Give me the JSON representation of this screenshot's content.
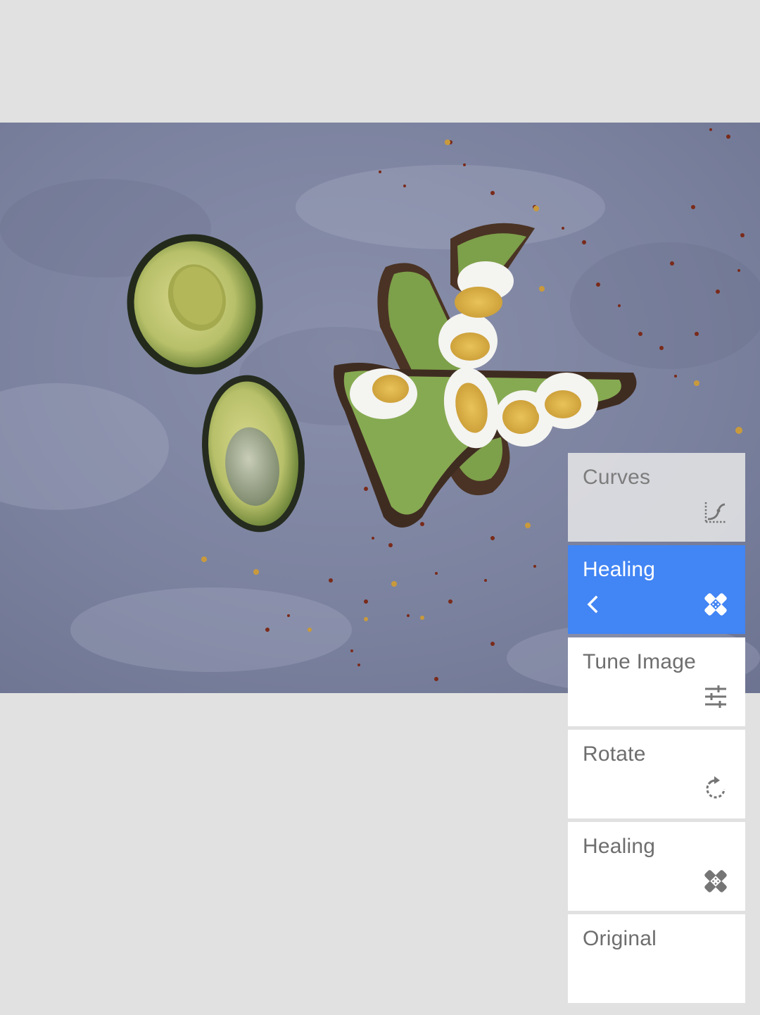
{
  "editor": {
    "photo_icon": "photo-canvas",
    "stack": [
      {
        "label": "Curves",
        "icon": "curves-icon",
        "state": "faded"
      },
      {
        "label": "Healing",
        "icon": "healing-icon",
        "state": "active",
        "back_icon": "chevron-left-icon"
      },
      {
        "label": "Tune Image",
        "icon": "tune-sliders-icon",
        "state": "normal"
      },
      {
        "label": "Rotate",
        "icon": "rotate-icon",
        "state": "normal"
      },
      {
        "label": "Healing",
        "icon": "healing-icon",
        "state": "normal"
      },
      {
        "label": "Original",
        "icon": "",
        "state": "normal"
      }
    ]
  },
  "colors": {
    "background": "#e1e1e1",
    "active": "#4285f4",
    "card": "#ffffff",
    "text": "#6e6e6e"
  }
}
